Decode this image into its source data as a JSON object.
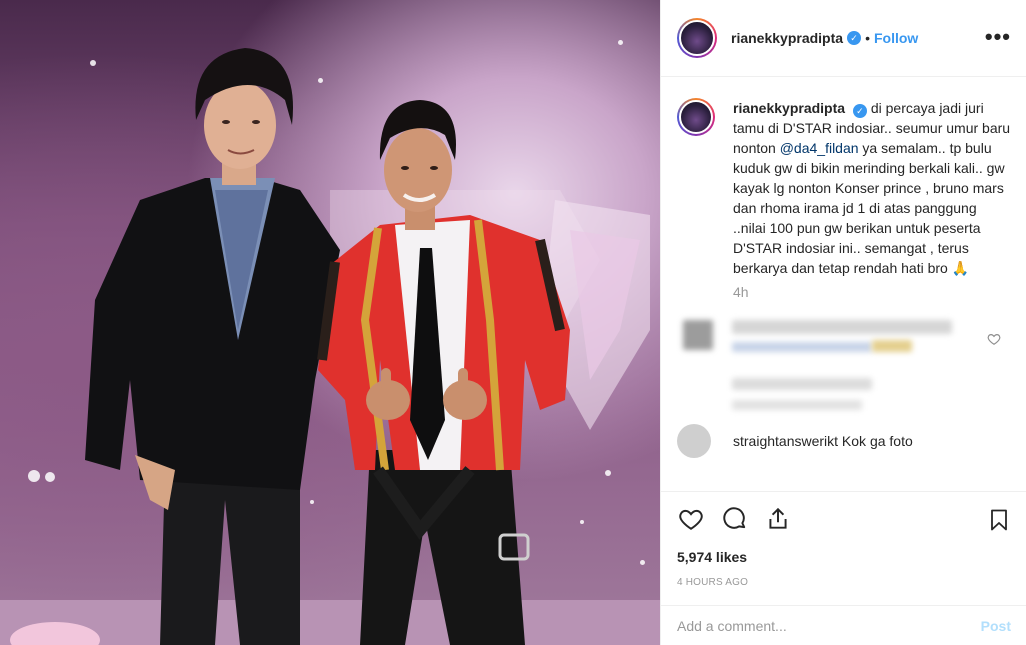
{
  "post": {
    "username": "rianekkypradipta",
    "follow_label": "Follow",
    "separator": "•",
    "more_label": "•••"
  },
  "caption": {
    "username": "rianekkypradipta",
    "text_before_mention": "di percaya jadi juri tamu di D'STAR indosiar.. seumur umur baru nonton ",
    "mention": "@da4_fildan",
    "text_after_mention": " ya semalam.. tp bulu kuduk gw di bikin merinding berkali kali.. gw kayak lg nonton Konser prince , bruno mars dan rhoma irama jd 1 di atas panggung ..nilai 100 pun gw berikan untuk peserta D'STAR indosiar ini.. semangat , terus berkarya dan tetap rendah hati bro 🙏",
    "time": "4h"
  },
  "comment2": {
    "text": "straightanswerikt Kok ga foto"
  },
  "stats": {
    "likes": "5,974 likes",
    "posted": "4 HOURS AGO"
  },
  "composer": {
    "placeholder": "Add a comment...",
    "post_label": "Post"
  },
  "colors": {
    "accent": "#3897f0",
    "post_disabled": "#b2dffc"
  }
}
